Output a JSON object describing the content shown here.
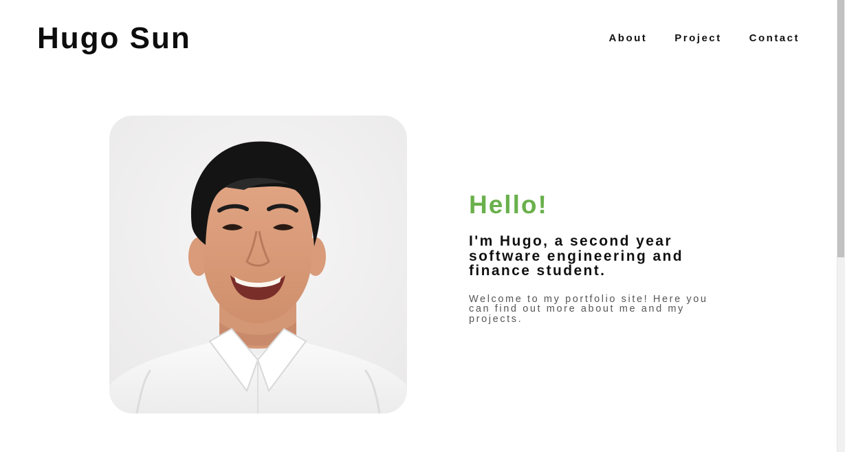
{
  "header": {
    "title": "Hugo Sun",
    "nav": [
      {
        "label": "About"
      },
      {
        "label": "Project"
      },
      {
        "label": "Contact"
      }
    ]
  },
  "hero": {
    "photo_alt": "Portrait photo of Hugo Sun",
    "greeting": "Hello!",
    "tagline": "I'm Hugo, a second year software engineering and finance student.",
    "description": "Welcome to my portfolio site! Here you can find out more about me and my projects."
  },
  "colors": {
    "accent": "#6ab04c",
    "text": "#111111",
    "muted": "#555555",
    "background": "#ffffff"
  }
}
